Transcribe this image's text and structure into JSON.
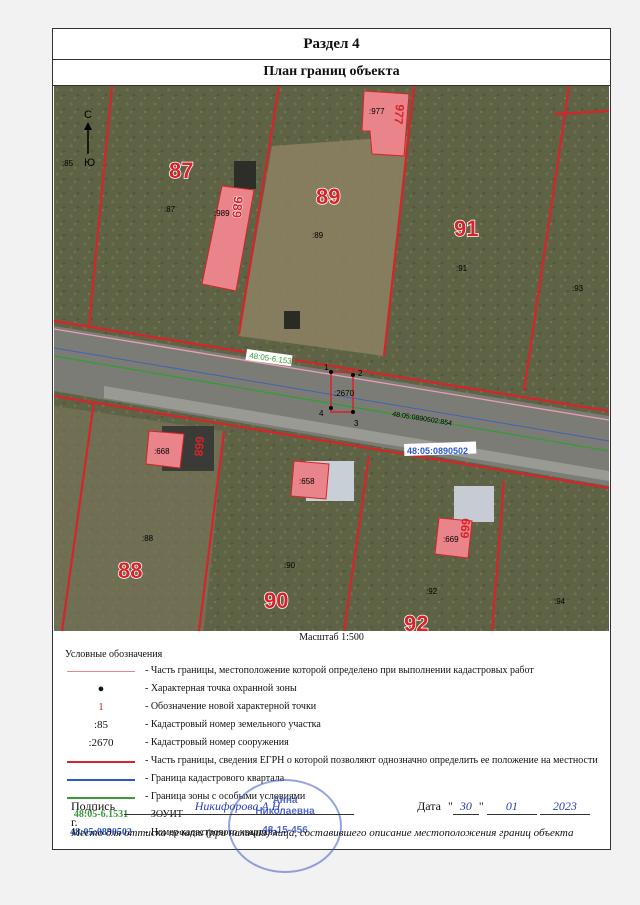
{
  "header": {
    "section": "Раздел 4",
    "title": "План границ объекта"
  },
  "map": {
    "north": "С",
    "south": "Ю",
    "labels": {
      "p85": ":85",
      "p87big": "87",
      "p87": ":87",
      "p989": ":989",
      "p989rot": "989",
      "p89big": "89",
      "p89": ":89",
      "p977": ":977",
      "p977rot": "977",
      "p91big": "91",
      "p91": ":91",
      "p93": ":93",
      "zone": "48:05-6.1531",
      "structure": ":2670",
      "road": "48:05:0890502:854",
      "quarter": "48:05:0890502",
      "p668": ":668",
      "p668rot": "668",
      "p658": ":658",
      "p669": ":669",
      "p669rot": "669",
      "p88": ":88",
      "p88big": "88",
      "p90": ":90",
      "p90big": "90",
      "p92": ":92",
      "p92big": "92",
      "p94": ":94"
    },
    "points": [
      "1",
      "2",
      "3",
      "4"
    ]
  },
  "scale": "Масштаб 1:500",
  "legend": {
    "title": "Условные обозначения",
    "items": [
      {
        "sym": "",
        "text": "- Часть границы, местоположение которой определено при выполнении кадастровых работ"
      },
      {
        "sym": "●",
        "text": "- Характерная точка охранной зоны"
      },
      {
        "sym": "1",
        "text": "- Обозначение новой характерной точки"
      },
      {
        "sym": ":85",
        "text": "- Кадастровый номер земельного участка"
      },
      {
        "sym": ":2670",
        "text": "- Кадастровый номер сооружения"
      },
      {
        "sym": "",
        "text": "- Часть границы, сведения ЕГРН о которой позволяют однозначно определить ее положение на местности"
      },
      {
        "sym": "",
        "text": "- Граница кадастрового квартала"
      },
      {
        "sym": "",
        "text": "- Граница зоны с особыми условиями"
      },
      {
        "sym": "48:05-6.1531",
        "text": "- ЗОУИТ"
      },
      {
        "sym": "48:05:0890502",
        "text": "- Номер кадастрового квартала"
      }
    ]
  },
  "signature": {
    "label": "Подпись",
    "name": "Никифорова А.Н.",
    "date_label": "Дата",
    "day": "30",
    "month": "01",
    "year": "2023",
    "year_suffix": "г."
  },
  "stamp": {
    "lines": [
      "Анна",
      "Николаевна",
      "48-15-456"
    ]
  },
  "place_note": "Место для оттиска печати (при наличии) лица, составившего описание местоположения границ объекта",
  "colors": {
    "red": "#d8232a",
    "blue": "#2b57c9",
    "green": "#3a9a3a",
    "pink": "#e9848b"
  }
}
